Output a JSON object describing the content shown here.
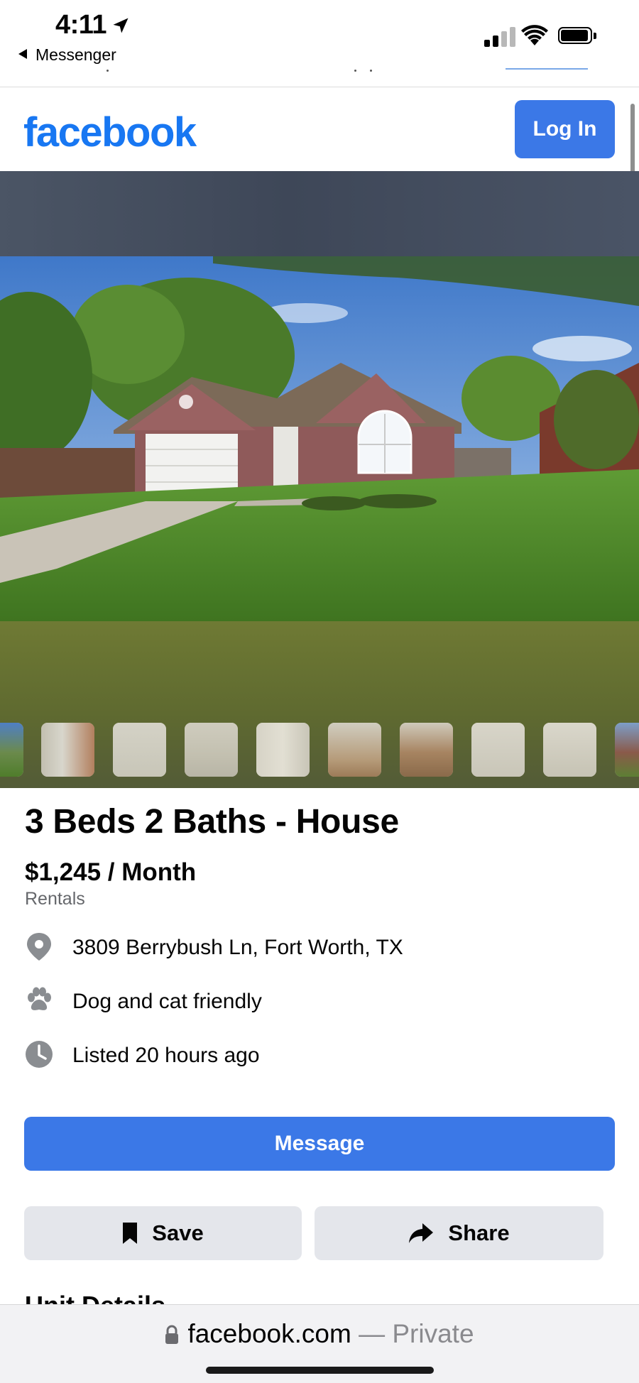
{
  "status_bar": {
    "time": "4:11",
    "back_app": "Messenger"
  },
  "header": {
    "logo": "facebook",
    "login_label": "Log In"
  },
  "listing": {
    "title": "3 Beds 2 Baths - House",
    "price": "$1,245 / Month",
    "category": "Rentals",
    "details": {
      "address": "3809 Berrybush Ln, Fort Worth, TX",
      "pets": "Dog and cat friendly",
      "listed": "Listed 20 hours ago"
    }
  },
  "actions": {
    "message_label": "Message",
    "save_label": "Save",
    "share_label": "Share"
  },
  "next_section": "Unit Details",
  "browser": {
    "domain": "facebook.com",
    "separator": "—",
    "mode": "Private"
  },
  "colors": {
    "brand_blue": "#1877f2",
    "button_blue": "#3b78e7",
    "secondary_button": "#e4e6eb",
    "muted_text": "#65676b"
  },
  "icons": [
    "location-arrow-icon",
    "back-triangle-icon",
    "cellular-signal-icon",
    "wifi-icon",
    "battery-icon",
    "location-pin-icon",
    "paw-icon",
    "clock-icon",
    "bookmark-icon",
    "share-arrow-icon",
    "lock-icon"
  ]
}
